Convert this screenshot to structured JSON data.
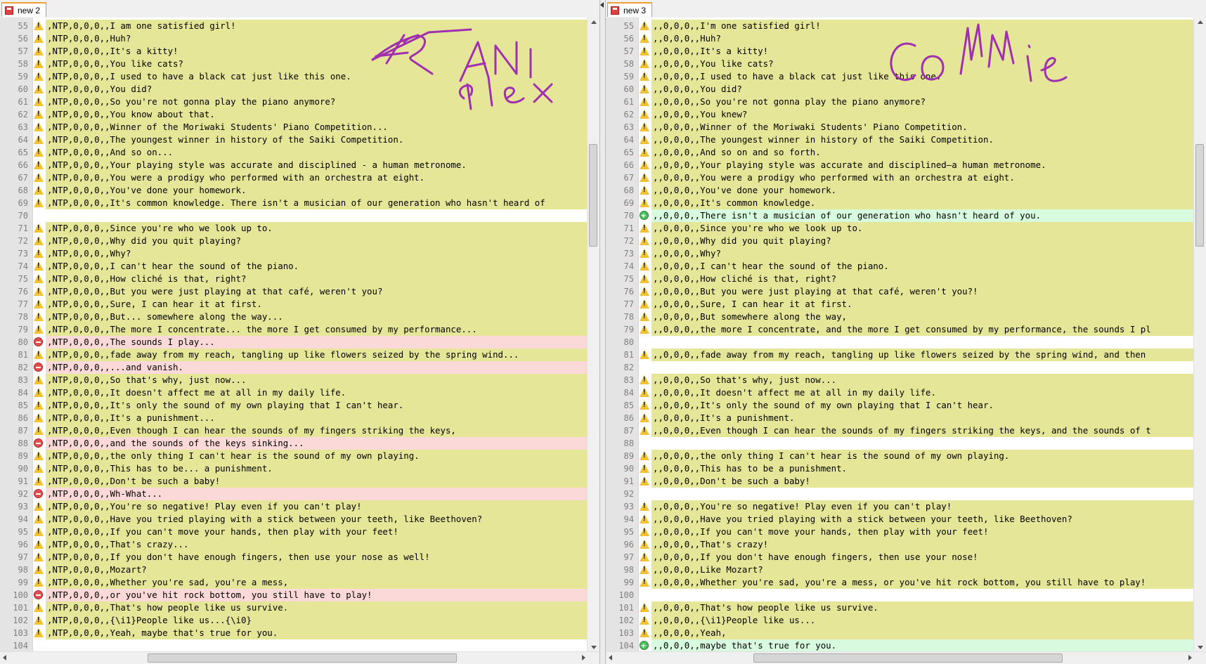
{
  "left": {
    "tab_label": "new 2",
    "rows": [
      {
        "ln": "55",
        "type": "changed",
        "text": ",NTP,0,0,0,,I am one satisfied girl!"
      },
      {
        "ln": "56",
        "type": "changed",
        "text": ",NTP,0,0,0,,Huh?"
      },
      {
        "ln": "57",
        "type": "changed",
        "text": ",NTP,0,0,0,,It's a kitty!"
      },
      {
        "ln": "58",
        "type": "changed",
        "text": ",NTP,0,0,0,,You like cats?"
      },
      {
        "ln": "59",
        "type": "changed",
        "text": ",NTP,0,0,0,,I used to have a black cat just like this one."
      },
      {
        "ln": "60",
        "type": "changed",
        "text": ",NTP,0,0,0,,You did?"
      },
      {
        "ln": "61",
        "type": "changed",
        "text": ",NTP,0,0,0,,So you're not gonna play the piano anymore?"
      },
      {
        "ln": "62",
        "type": "changed",
        "text": ",NTP,0,0,0,,You know about that."
      },
      {
        "ln": "63",
        "type": "changed",
        "text": ",NTP,0,0,0,,Winner of the Moriwaki Students' Piano Competition..."
      },
      {
        "ln": "64",
        "type": "changed",
        "text": ",NTP,0,0,0,,The youngest winner in history of the Saiki Competition."
      },
      {
        "ln": "65",
        "type": "changed",
        "text": ",NTP,0,0,0,,And so on..."
      },
      {
        "ln": "66",
        "type": "changed",
        "text": ",NTP,0,0,0,,Your playing style was accurate and disciplined - a human metronome."
      },
      {
        "ln": "67",
        "type": "changed",
        "text": ",NTP,0,0,0,,You were a prodigy who performed with an orchestra at eight."
      },
      {
        "ln": "68",
        "type": "changed",
        "text": ",NTP,0,0,0,,You've done your homework."
      },
      {
        "ln": "69",
        "type": "changed",
        "text": ",NTP,0,0,0,,It's common knowledge. There isn't a musician of our generation who hasn't heard of"
      },
      {
        "ln": "70",
        "type": "blank",
        "text": ""
      },
      {
        "ln": "71",
        "type": "changed",
        "text": ",NTP,0,0,0,,Since you're who we look up to."
      },
      {
        "ln": "72",
        "type": "changed",
        "text": ",NTP,0,0,0,,Why did you quit playing?"
      },
      {
        "ln": "73",
        "type": "changed",
        "text": ",NTP,0,0,0,,Why?"
      },
      {
        "ln": "74",
        "type": "changed",
        "text": ",NTP,0,0,0,,I can't hear the sound of the piano."
      },
      {
        "ln": "75",
        "type": "changed",
        "text": ",NTP,0,0,0,,How cliché is that, right?"
      },
      {
        "ln": "76",
        "type": "changed",
        "text": ",NTP,0,0,0,,But you were just playing at that café, weren't you?"
      },
      {
        "ln": "77",
        "type": "changed",
        "text": ",NTP,0,0,0,,Sure, I can hear it at first."
      },
      {
        "ln": "78",
        "type": "changed",
        "text": ",NTP,0,0,0,,But... somewhere along the way..."
      },
      {
        "ln": "79",
        "type": "changed",
        "text": ",NTP,0,0,0,,The more I concentrate... the more I get consumed by my performance..."
      },
      {
        "ln": "80",
        "type": "removed",
        "text": ",NTP,0,0,0,,The sounds I play..."
      },
      {
        "ln": "81",
        "type": "changed",
        "text": ",NTP,0,0,0,,fade away from my reach, tangling up like flowers seized by the spring wind..."
      },
      {
        "ln": "82",
        "type": "removed",
        "text": ",NTP,0,0,0,,...and vanish."
      },
      {
        "ln": "83",
        "type": "changed",
        "text": ",NTP,0,0,0,,So that's why, just now..."
      },
      {
        "ln": "84",
        "type": "changed",
        "text": ",NTP,0,0,0,,It doesn't affect me at all in my daily life."
      },
      {
        "ln": "85",
        "type": "changed",
        "text": ",NTP,0,0,0,,It's only the sound of my own playing that I can't hear."
      },
      {
        "ln": "86",
        "type": "changed",
        "text": ",NTP,0,0,0,,It's a punishment..."
      },
      {
        "ln": "87",
        "type": "changed",
        "text": ",NTP,0,0,0,,Even though I can hear the sounds of my fingers striking the keys,"
      },
      {
        "ln": "88",
        "type": "removed",
        "text": ",NTP,0,0,0,,and the sounds of the keys sinking..."
      },
      {
        "ln": "89",
        "type": "changed",
        "text": ",NTP,0,0,0,,the only thing I can't hear is the sound of my own playing."
      },
      {
        "ln": "90",
        "type": "changed",
        "text": ",NTP,0,0,0,,This has to be... a punishment."
      },
      {
        "ln": "91",
        "type": "changed",
        "text": ",NTP,0,0,0,,Don't be such a baby!"
      },
      {
        "ln": "92",
        "type": "removed",
        "text": ",NTP,0,0,0,,Wh-What..."
      },
      {
        "ln": "93",
        "type": "changed",
        "text": ",NTP,0,0,0,,You're so negative! Play even if you can't play!"
      },
      {
        "ln": "94",
        "type": "changed",
        "text": ",NTP,0,0,0,,Have you tried playing with a stick between your teeth, like Beethoven?"
      },
      {
        "ln": "95",
        "type": "changed",
        "text": ",NTP,0,0,0,,If you can't move your hands, then play with your feet!"
      },
      {
        "ln": "96",
        "type": "changed",
        "text": ",NTP,0,0,0,,That's crazy..."
      },
      {
        "ln": "97",
        "type": "changed",
        "text": ",NTP,0,0,0,,If you don't have enough fingers, then use your nose as well!"
      },
      {
        "ln": "98",
        "type": "changed",
        "text": ",NTP,0,0,0,,Mozart?"
      },
      {
        "ln": "99",
        "type": "changed",
        "text": ",NTP,0,0,0,,Whether you're sad, you're a mess,"
      },
      {
        "ln": "100",
        "type": "removed",
        "text": ",NTP,0,0,0,,or you've hit rock bottom, you still have to play!"
      },
      {
        "ln": "101",
        "type": "changed",
        "text": ",NTP,0,0,0,,That's how people like us survive."
      },
      {
        "ln": "102",
        "type": "changed",
        "text": ",NTP,0,0,0,,{\\i1}People like us...{\\i0}"
      },
      {
        "ln": "103",
        "type": "changed",
        "text": ",NTP,0,0,0,,Yeah, maybe that's true for you."
      },
      {
        "ln": "104",
        "type": "blank",
        "text": ""
      }
    ]
  },
  "right": {
    "tab_label": "new 3",
    "rows": [
      {
        "ln": "55",
        "type": "changed",
        "text": ",,0,0,0,,I'm one satisfied girl!"
      },
      {
        "ln": "56",
        "type": "changed",
        "text": ",,0,0,0,,Huh?"
      },
      {
        "ln": "57",
        "type": "changed",
        "text": ",,0,0,0,,It's a kitty!"
      },
      {
        "ln": "58",
        "type": "changed",
        "text": ",,0,0,0,,You like cats?"
      },
      {
        "ln": "59",
        "type": "changed",
        "text": ",,0,0,0,,I used to have a black cat just like this one."
      },
      {
        "ln": "60",
        "type": "changed",
        "text": ",,0,0,0,,You did?"
      },
      {
        "ln": "61",
        "type": "changed",
        "text": ",,0,0,0,,So you're not gonna play the piano anymore?"
      },
      {
        "ln": "62",
        "type": "changed",
        "text": ",,0,0,0,,You knew?"
      },
      {
        "ln": "63",
        "type": "changed",
        "text": ",,0,0,0,,Winner of the Moriwaki Students' Piano Competition."
      },
      {
        "ln": "64",
        "type": "changed",
        "text": ",,0,0,0,,The youngest winner in history of the Saiki Competition."
      },
      {
        "ln": "65",
        "type": "changed",
        "text": ",,0,0,0,,And so on and so forth."
      },
      {
        "ln": "66",
        "type": "changed",
        "text": ",,0,0,0,,Your playing style was accurate and disciplined—a human metronome."
      },
      {
        "ln": "67",
        "type": "changed",
        "text": ",,0,0,0,,You were a prodigy who performed with an orchestra at eight."
      },
      {
        "ln": "68",
        "type": "changed",
        "text": ",,0,0,0,,You've done your homework."
      },
      {
        "ln": "69",
        "type": "changed",
        "text": ",,0,0,0,,It's common knowledge."
      },
      {
        "ln": "70",
        "type": "added",
        "text": ",,0,0,0,,There isn't a musician of our generation who hasn't heard of you."
      },
      {
        "ln": "71",
        "type": "changed",
        "text": ",,0,0,0,,Since you're who we look up to."
      },
      {
        "ln": "72",
        "type": "changed",
        "text": ",,0,0,0,,Why did you quit playing?"
      },
      {
        "ln": "73",
        "type": "changed",
        "text": ",,0,0,0,,Why?"
      },
      {
        "ln": "74",
        "type": "changed",
        "text": ",,0,0,0,,I can't hear the sound of the piano."
      },
      {
        "ln": "75",
        "type": "changed",
        "text": ",,0,0,0,,How cliché is that, right?"
      },
      {
        "ln": "76",
        "type": "changed",
        "text": ",,0,0,0,,But you were just playing at that café, weren't you?!"
      },
      {
        "ln": "77",
        "type": "changed",
        "text": ",,0,0,0,,Sure, I can hear it at first."
      },
      {
        "ln": "78",
        "type": "changed",
        "text": ",,0,0,0,,But somewhere along the way,"
      },
      {
        "ln": "79",
        "type": "changed",
        "text": ",,0,0,0,,the more I concentrate, and the more I get consumed by my performance, the sounds I pl"
      },
      {
        "ln": "80",
        "type": "blank",
        "text": ""
      },
      {
        "ln": "81",
        "type": "changed",
        "text": ",,0,0,0,,fade away from my reach, tangling up like flowers seized by the spring wind, and then"
      },
      {
        "ln": "82",
        "type": "blank",
        "text": ""
      },
      {
        "ln": "83",
        "type": "changed",
        "text": ",,0,0,0,,So that's why, just now..."
      },
      {
        "ln": "84",
        "type": "changed",
        "text": ",,0,0,0,,It doesn't affect me at all in my daily life."
      },
      {
        "ln": "85",
        "type": "changed",
        "text": ",,0,0,0,,It's only the sound of my own playing that I can't hear."
      },
      {
        "ln": "86",
        "type": "changed",
        "text": ",,0,0,0,,It's a punishment."
      },
      {
        "ln": "87",
        "type": "changed",
        "text": ",,0,0,0,,Even though I can hear the sounds of my fingers striking the keys, and the sounds of t"
      },
      {
        "ln": "88",
        "type": "blank",
        "text": ""
      },
      {
        "ln": "89",
        "type": "changed",
        "text": ",,0,0,0,,the only thing I can't hear is the sound of my own playing."
      },
      {
        "ln": "90",
        "type": "changed",
        "text": ",,0,0,0,,This has to be a punishment."
      },
      {
        "ln": "91",
        "type": "changed",
        "text": ",,0,0,0,,Don't be such a baby!"
      },
      {
        "ln": "92",
        "type": "blank",
        "text": ""
      },
      {
        "ln": "93",
        "type": "changed",
        "text": ",,0,0,0,,You're so negative! Play even if you can't play!"
      },
      {
        "ln": "94",
        "type": "changed",
        "text": ",,0,0,0,,Have you tried playing with a stick between your teeth, like Beethoven?"
      },
      {
        "ln": "95",
        "type": "changed",
        "text": ",,0,0,0,,If you can't move your hands, then play with your feet!"
      },
      {
        "ln": "96",
        "type": "changed",
        "text": ",,0,0,0,,That's crazy!"
      },
      {
        "ln": "97",
        "type": "changed",
        "text": ",,0,0,0,,If you don't have enough fingers, then use your nose!"
      },
      {
        "ln": "98",
        "type": "changed",
        "text": ",,0,0,0,,Like Mozart?"
      },
      {
        "ln": "99",
        "type": "changed",
        "text": ",,0,0,0,,Whether you're sad, you're a mess, or you've hit rock bottom, you still have to play!"
      },
      {
        "ln": "100",
        "type": "blank",
        "text": ""
      },
      {
        "ln": "101",
        "type": "changed",
        "text": ",,0,0,0,,That's how people like us survive."
      },
      {
        "ln": "102",
        "type": "changed",
        "text": ",,0,0,0,,{\\i1}People like us..."
      },
      {
        "ln": "103",
        "type": "changed",
        "text": ",,0,0,0,,Yeah,"
      },
      {
        "ln": "104",
        "type": "added",
        "text": ",,0,0,0,,maybe that's true for you."
      }
    ]
  },
  "annotations": {
    "left_scribble": "ANi plex",
    "right_scribble": "Commie",
    "ink_color": "#a030b0"
  },
  "colors": {
    "changed": "#e6e699",
    "removed": "#fcd9d9",
    "added": "#d8fbe0",
    "blank": "#e1e1e1"
  }
}
